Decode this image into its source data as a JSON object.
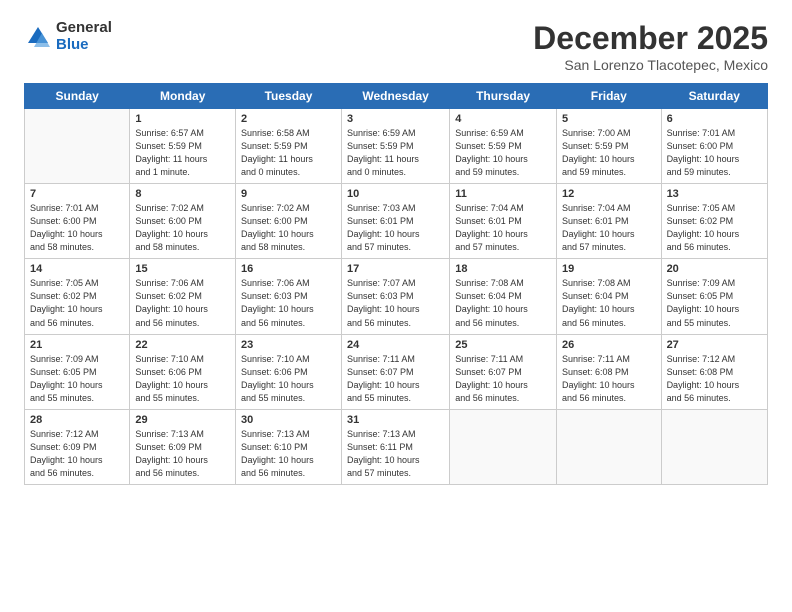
{
  "logo": {
    "general": "General",
    "blue": "Blue"
  },
  "title": "December 2025",
  "subtitle": "San Lorenzo Tlacotepec, Mexico",
  "days_of_week": [
    "Sunday",
    "Monday",
    "Tuesday",
    "Wednesday",
    "Thursday",
    "Friday",
    "Saturday"
  ],
  "weeks": [
    [
      {
        "num": "",
        "info": ""
      },
      {
        "num": "1",
        "info": "Sunrise: 6:57 AM\nSunset: 5:59 PM\nDaylight: 11 hours\nand 1 minute."
      },
      {
        "num": "2",
        "info": "Sunrise: 6:58 AM\nSunset: 5:59 PM\nDaylight: 11 hours\nand 0 minutes."
      },
      {
        "num": "3",
        "info": "Sunrise: 6:59 AM\nSunset: 5:59 PM\nDaylight: 11 hours\nand 0 minutes."
      },
      {
        "num": "4",
        "info": "Sunrise: 6:59 AM\nSunset: 5:59 PM\nDaylight: 10 hours\nand 59 minutes."
      },
      {
        "num": "5",
        "info": "Sunrise: 7:00 AM\nSunset: 5:59 PM\nDaylight: 10 hours\nand 59 minutes."
      },
      {
        "num": "6",
        "info": "Sunrise: 7:01 AM\nSunset: 6:00 PM\nDaylight: 10 hours\nand 59 minutes."
      }
    ],
    [
      {
        "num": "7",
        "info": "Sunrise: 7:01 AM\nSunset: 6:00 PM\nDaylight: 10 hours\nand 58 minutes."
      },
      {
        "num": "8",
        "info": "Sunrise: 7:02 AM\nSunset: 6:00 PM\nDaylight: 10 hours\nand 58 minutes."
      },
      {
        "num": "9",
        "info": "Sunrise: 7:02 AM\nSunset: 6:00 PM\nDaylight: 10 hours\nand 58 minutes."
      },
      {
        "num": "10",
        "info": "Sunrise: 7:03 AM\nSunset: 6:01 PM\nDaylight: 10 hours\nand 57 minutes."
      },
      {
        "num": "11",
        "info": "Sunrise: 7:04 AM\nSunset: 6:01 PM\nDaylight: 10 hours\nand 57 minutes."
      },
      {
        "num": "12",
        "info": "Sunrise: 7:04 AM\nSunset: 6:01 PM\nDaylight: 10 hours\nand 57 minutes."
      },
      {
        "num": "13",
        "info": "Sunrise: 7:05 AM\nSunset: 6:02 PM\nDaylight: 10 hours\nand 56 minutes."
      }
    ],
    [
      {
        "num": "14",
        "info": "Sunrise: 7:05 AM\nSunset: 6:02 PM\nDaylight: 10 hours\nand 56 minutes."
      },
      {
        "num": "15",
        "info": "Sunrise: 7:06 AM\nSunset: 6:02 PM\nDaylight: 10 hours\nand 56 minutes."
      },
      {
        "num": "16",
        "info": "Sunrise: 7:06 AM\nSunset: 6:03 PM\nDaylight: 10 hours\nand 56 minutes."
      },
      {
        "num": "17",
        "info": "Sunrise: 7:07 AM\nSunset: 6:03 PM\nDaylight: 10 hours\nand 56 minutes."
      },
      {
        "num": "18",
        "info": "Sunrise: 7:08 AM\nSunset: 6:04 PM\nDaylight: 10 hours\nand 56 minutes."
      },
      {
        "num": "19",
        "info": "Sunrise: 7:08 AM\nSunset: 6:04 PM\nDaylight: 10 hours\nand 56 minutes."
      },
      {
        "num": "20",
        "info": "Sunrise: 7:09 AM\nSunset: 6:05 PM\nDaylight: 10 hours\nand 55 minutes."
      }
    ],
    [
      {
        "num": "21",
        "info": "Sunrise: 7:09 AM\nSunset: 6:05 PM\nDaylight: 10 hours\nand 55 minutes."
      },
      {
        "num": "22",
        "info": "Sunrise: 7:10 AM\nSunset: 6:06 PM\nDaylight: 10 hours\nand 55 minutes."
      },
      {
        "num": "23",
        "info": "Sunrise: 7:10 AM\nSunset: 6:06 PM\nDaylight: 10 hours\nand 55 minutes."
      },
      {
        "num": "24",
        "info": "Sunrise: 7:11 AM\nSunset: 6:07 PM\nDaylight: 10 hours\nand 55 minutes."
      },
      {
        "num": "25",
        "info": "Sunrise: 7:11 AM\nSunset: 6:07 PM\nDaylight: 10 hours\nand 56 minutes."
      },
      {
        "num": "26",
        "info": "Sunrise: 7:11 AM\nSunset: 6:08 PM\nDaylight: 10 hours\nand 56 minutes."
      },
      {
        "num": "27",
        "info": "Sunrise: 7:12 AM\nSunset: 6:08 PM\nDaylight: 10 hours\nand 56 minutes."
      }
    ],
    [
      {
        "num": "28",
        "info": "Sunrise: 7:12 AM\nSunset: 6:09 PM\nDaylight: 10 hours\nand 56 minutes."
      },
      {
        "num": "29",
        "info": "Sunrise: 7:13 AM\nSunset: 6:09 PM\nDaylight: 10 hours\nand 56 minutes."
      },
      {
        "num": "30",
        "info": "Sunrise: 7:13 AM\nSunset: 6:10 PM\nDaylight: 10 hours\nand 56 minutes."
      },
      {
        "num": "31",
        "info": "Sunrise: 7:13 AM\nSunset: 6:11 PM\nDaylight: 10 hours\nand 57 minutes."
      },
      {
        "num": "",
        "info": ""
      },
      {
        "num": "",
        "info": ""
      },
      {
        "num": "",
        "info": ""
      }
    ]
  ]
}
